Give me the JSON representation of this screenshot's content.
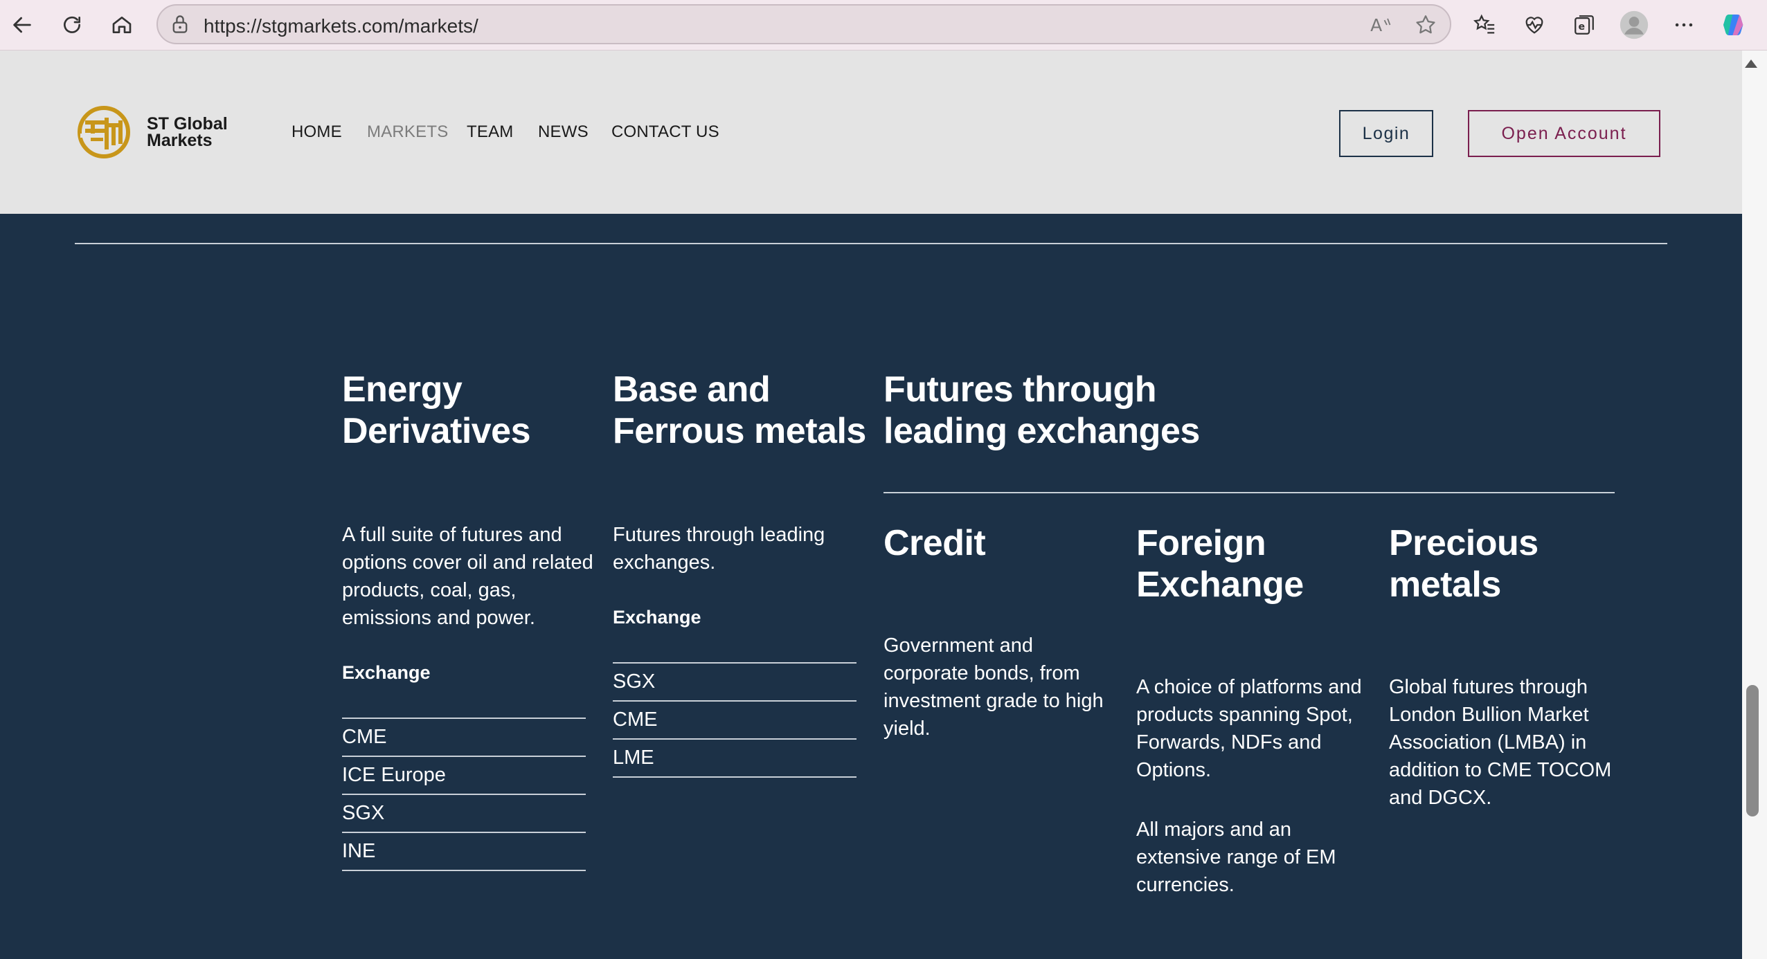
{
  "browser": {
    "url": "https://stgmarkets.com/markets/"
  },
  "site": {
    "brand_line1": "ST Global",
    "brand_line2": "Markets",
    "nav": {
      "home": "HOME",
      "markets": "MARKETS",
      "team": "TEAM",
      "news": "NEWS",
      "contact": "CONTACT US"
    },
    "login": "Login",
    "open_account": "Open Account",
    "brand_color": "#c8961a",
    "accent_color": "#7a1e4e"
  },
  "sections": {
    "energy": {
      "title": "Energy Derivatives",
      "description": "A full suite of futures and options cover oil and related products, coal, gas, emissions and power.",
      "exchange_label": "Exchange",
      "exchanges": [
        "CME",
        "ICE Europe",
        "SGX",
        "INE"
      ]
    },
    "base_metals": {
      "title": "Base and Ferrous metals",
      "description": "Futures through leading exchanges.",
      "exchange_label": "Exchange",
      "exchanges": [
        "SGX",
        "CME",
        "LME"
      ]
    },
    "futures": {
      "title": "Futures through leading exchanges"
    },
    "credit": {
      "title": "Credit",
      "description": "Government and corporate bonds, from investment grade to high yield."
    },
    "fx": {
      "title": "Foreign Exchange",
      "description": "A choice of platforms and products spanning Spot, Forwards, NDFs and Options.",
      "description2": "All majors and an extensive range of EM currencies."
    },
    "precious": {
      "title": "Precious metals",
      "description": "Global futures through London Bullion Market Association (LMBA) in addition to CME TOCOM and DGCX."
    }
  }
}
